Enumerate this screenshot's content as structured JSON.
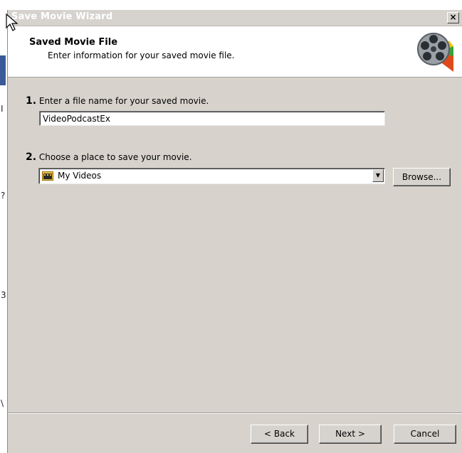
{
  "window": {
    "title": "Save Movie Wizard",
    "close_label": "×"
  },
  "header": {
    "title": "Saved Movie File",
    "subtitle": "Enter information for your saved movie file.",
    "icon": "film-reel-icon"
  },
  "steps": [
    {
      "number": "1.",
      "label": "Enter a file name for your saved movie."
    },
    {
      "number": "2.",
      "label": "Choose a place to save your movie."
    }
  ],
  "filename": {
    "value": "VideoPodcastEx"
  },
  "location": {
    "value": "My Videos",
    "icon": "folder-icon"
  },
  "buttons": {
    "browse": "Browse...",
    "back": "< Back",
    "next": "Next >",
    "cancel": "Cancel"
  },
  "colors": {
    "dialog_bg": "#d7d3cc",
    "header_bg": "#ffffff"
  }
}
